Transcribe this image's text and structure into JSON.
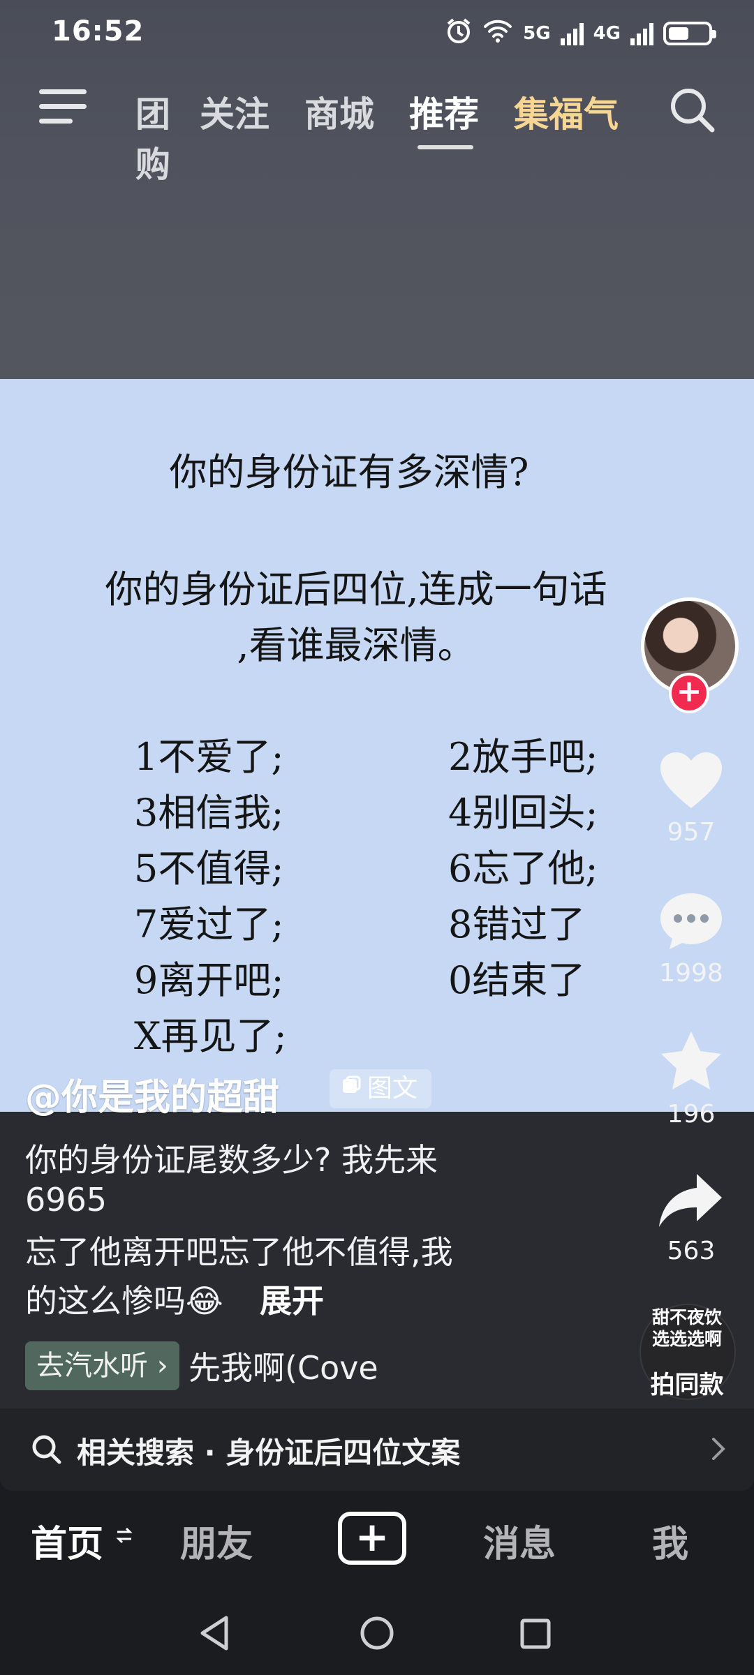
{
  "status": {
    "time": "16:52",
    "net1": "5G",
    "net2": "4G"
  },
  "nav": {
    "tabs": [
      {
        "label": "团购"
      },
      {
        "label": "关注"
      },
      {
        "label": "商城"
      },
      {
        "label": "推荐"
      },
      {
        "label": "集福气"
      }
    ]
  },
  "post": {
    "card": {
      "title": "你的身份证有多深情?",
      "line1": "你的身份证后四位,连成一句话",
      "line2": ",看谁最深情。",
      "codes": [
        "1不爱了;",
        "2放手吧;",
        "3相信我;",
        "4别回头;",
        "5不值得;",
        "6忘了他;",
        "7爱过了;",
        "8错过了",
        "9离开吧;",
        "0结束了",
        "X再见了;"
      ]
    },
    "author": "@你是我的超甜",
    "type_badge": "图文",
    "description": [
      "你的身份证尾数多少? 我先来",
      "6965",
      "忘了他离开吧忘了他不值得,我",
      "的这么惨吗😂"
    ],
    "expand_label": "展开",
    "music_tag": "去汽水听 ›",
    "music_title": "先我啊(Cove",
    "same_style_top": "甜不夜饮 选选选啊",
    "same_style_label": "拍同款"
  },
  "actions": {
    "likes": "957",
    "comments": "1998",
    "favorites": "196",
    "shares": "563"
  },
  "related": {
    "text": "相关搜索 · 身份证后四位文案"
  },
  "bottom_nav": {
    "home": "首页",
    "friends": "朋友",
    "messages": "消息",
    "me": "我"
  }
}
